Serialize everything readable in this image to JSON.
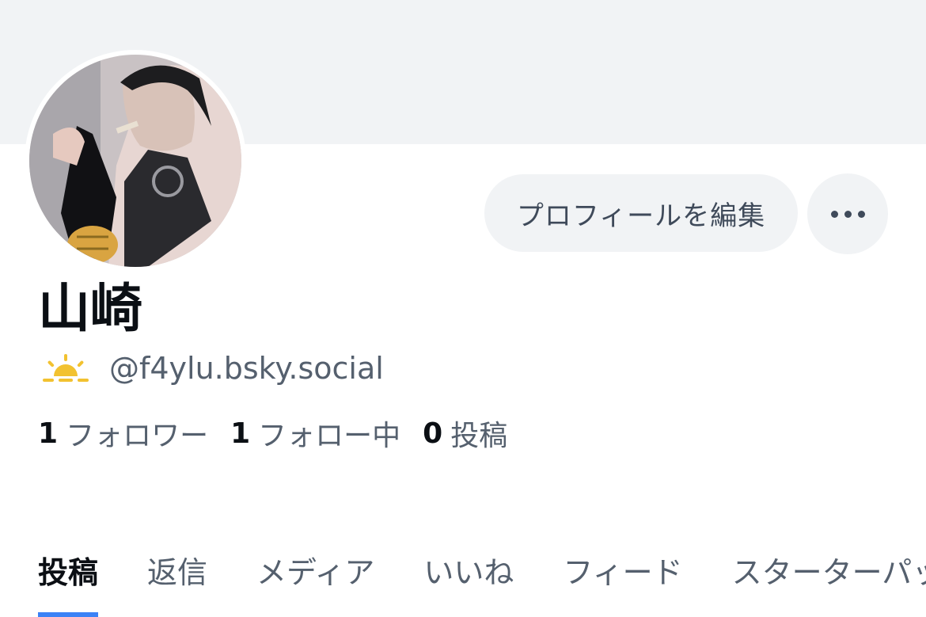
{
  "profile": {
    "display_name": "山崎",
    "handle": "@f4ylu.bsky.social",
    "handle_emoji_icon": "sunrise-icon",
    "avatar_icon": "avatar-illustration"
  },
  "actions": {
    "edit_profile_label": "プロフィールを編集",
    "more_icon": "ellipsis-icon"
  },
  "stats": {
    "followers": {
      "count": "1",
      "label": "フォロワー"
    },
    "following": {
      "count": "1",
      "label": "フォロー中"
    },
    "posts": {
      "count": "0",
      "label": "投稿"
    }
  },
  "tabs": [
    {
      "label": "投稿",
      "active": true
    },
    {
      "label": "返信",
      "active": false
    },
    {
      "label": "メディア",
      "active": false
    },
    {
      "label": "いいね",
      "active": false
    },
    {
      "label": "フィード",
      "active": false
    },
    {
      "label": "スターターパック",
      "active": false
    }
  ],
  "colors": {
    "accent": "#3b82f6",
    "banner": "#f1f3f5",
    "muted_text": "#55606e"
  }
}
